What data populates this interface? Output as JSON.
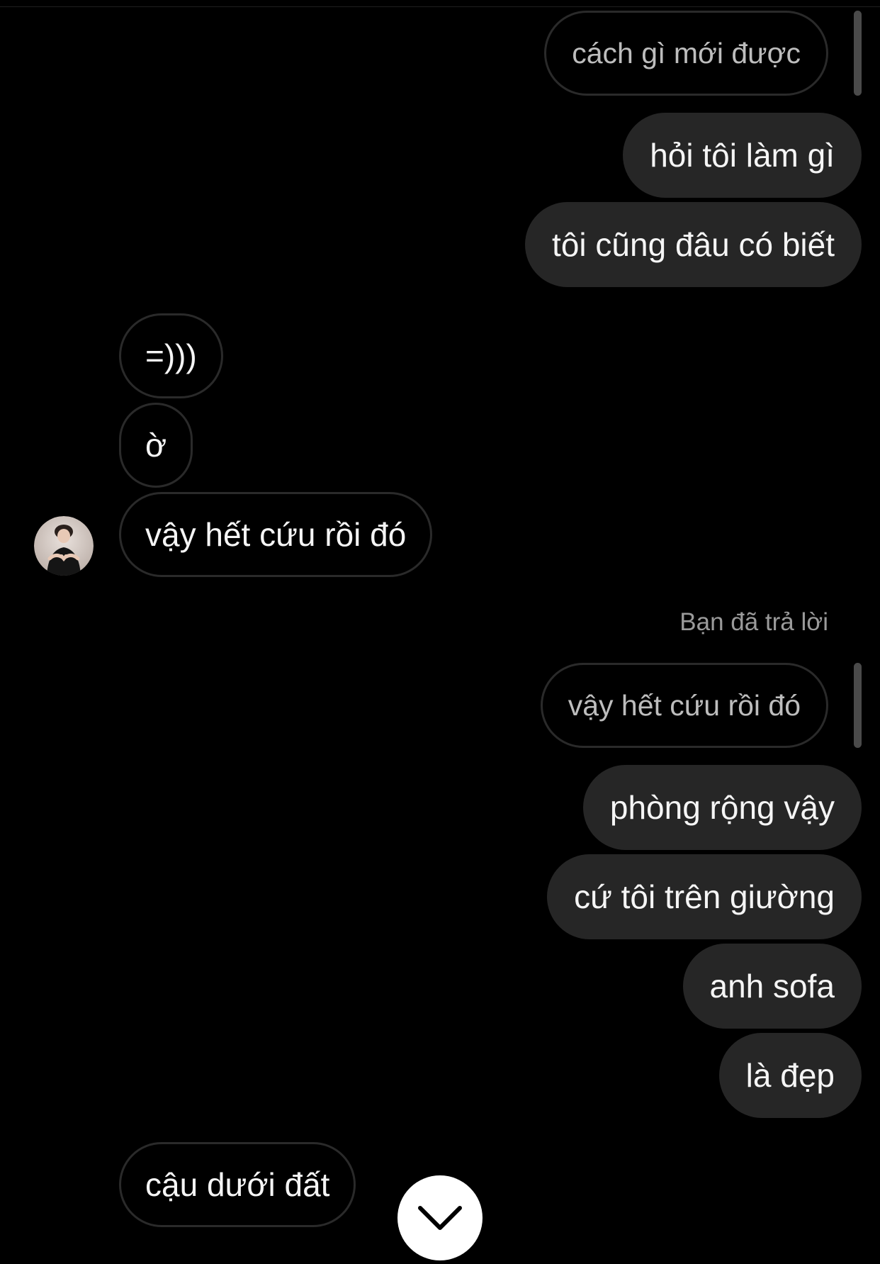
{
  "conversation": {
    "messages_top": [
      {
        "id": "q1",
        "kind": "reply-quote",
        "text": "cách gì mới được"
      },
      {
        "id": "m1",
        "kind": "outgoing",
        "text": "hỏi tôi làm gì"
      },
      {
        "id": "m2",
        "kind": "outgoing",
        "text": "tôi cũng đâu có biết"
      },
      {
        "id": "m3",
        "kind": "incoming",
        "text": "=)))"
      },
      {
        "id": "m4",
        "kind": "incoming",
        "text": "ờ"
      },
      {
        "id": "m5",
        "kind": "incoming",
        "text": "vậy hết cứu rồi đó"
      }
    ],
    "reply_caption": "Bạn đã trả lời",
    "reply_quote": "vậy hết cứu rồi đó",
    "messages_bottom": [
      {
        "id": "m6",
        "kind": "outgoing",
        "text": "phòng rộng vậy"
      },
      {
        "id": "m7",
        "kind": "outgoing",
        "text": "cứ tôi trên giường"
      },
      {
        "id": "m8",
        "kind": "outgoing",
        "text": "anh sofa"
      },
      {
        "id": "m9",
        "kind": "outgoing",
        "text": "là đẹp"
      },
      {
        "id": "m10",
        "kind": "incoming",
        "text": "cậu dưới đất"
      }
    ]
  },
  "avatar": {
    "icon": "profile-photo"
  },
  "scroll_button": {
    "icon": "chevron-down-icon"
  },
  "colors": {
    "background": "#000000",
    "outgoing_bubble": "#262626",
    "incoming_border": "#2a2a2a",
    "text": "#f5f5f5",
    "muted": "#9a9a9a"
  }
}
